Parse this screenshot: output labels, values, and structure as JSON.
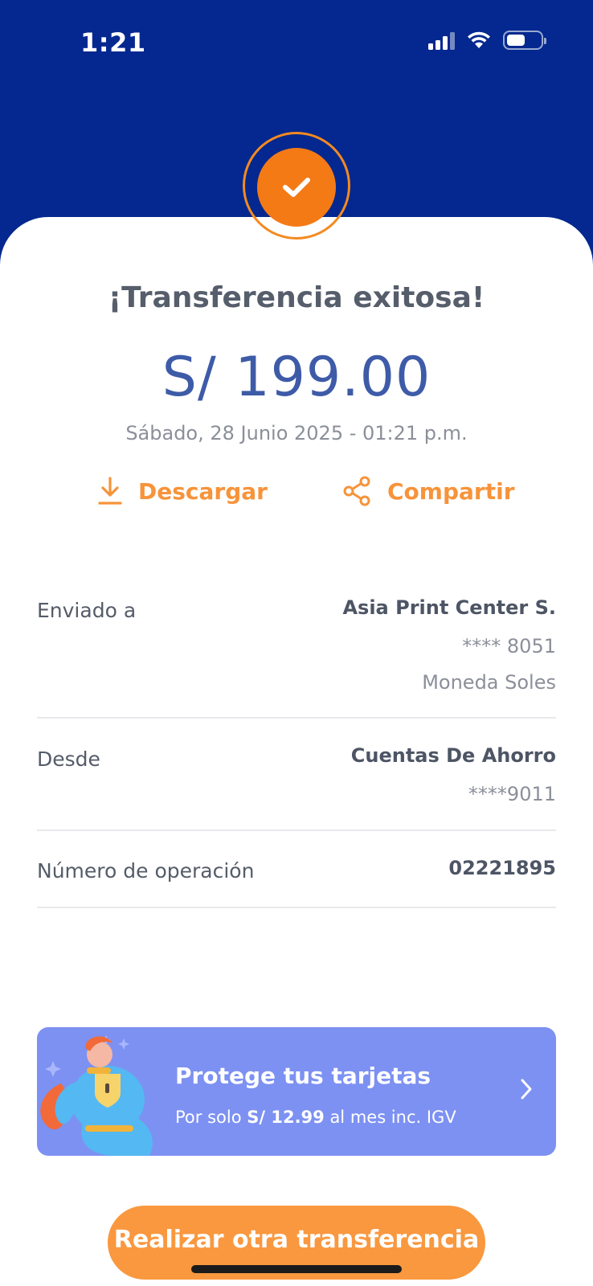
{
  "status_bar": {
    "time": "1:21"
  },
  "receipt": {
    "title": "¡Transferencia exitosa!",
    "amount": "S/ 199.00",
    "datetime": "Sábado, 28 Junio 2025 - 01:21 p.m."
  },
  "actions": {
    "download_label": "Descargar",
    "share_label": "Compartir"
  },
  "details": {
    "sent_to": {
      "label": "Enviado a",
      "name": "Asia Print Center S.",
      "account": "**** 8051",
      "currency": "Moneda Soles"
    },
    "from": {
      "label": "Desde",
      "account_type": "Cuentas De Ahorro",
      "account": "****9011"
    },
    "operation": {
      "label": "Número de operación",
      "number": "02221895"
    }
  },
  "promo": {
    "title": "Protege tus tarjetas",
    "sub_prefix": "Por solo ",
    "price": "S/ 12.99",
    "sub_suffix": " al mes inc. IGV"
  },
  "cta": {
    "label": "Realizar otra transferencia"
  },
  "colors": {
    "header_blue": "#04288f",
    "accent_orange": "#f47a16",
    "amount_blue": "#3e5ba8",
    "promo_purple": "#7d91f2"
  },
  "icons": [
    "check-icon",
    "download-icon",
    "share-icon",
    "chevron-right-icon",
    "cellular-signal-icon",
    "wifi-icon",
    "battery-icon",
    "superhero-illustration"
  ]
}
